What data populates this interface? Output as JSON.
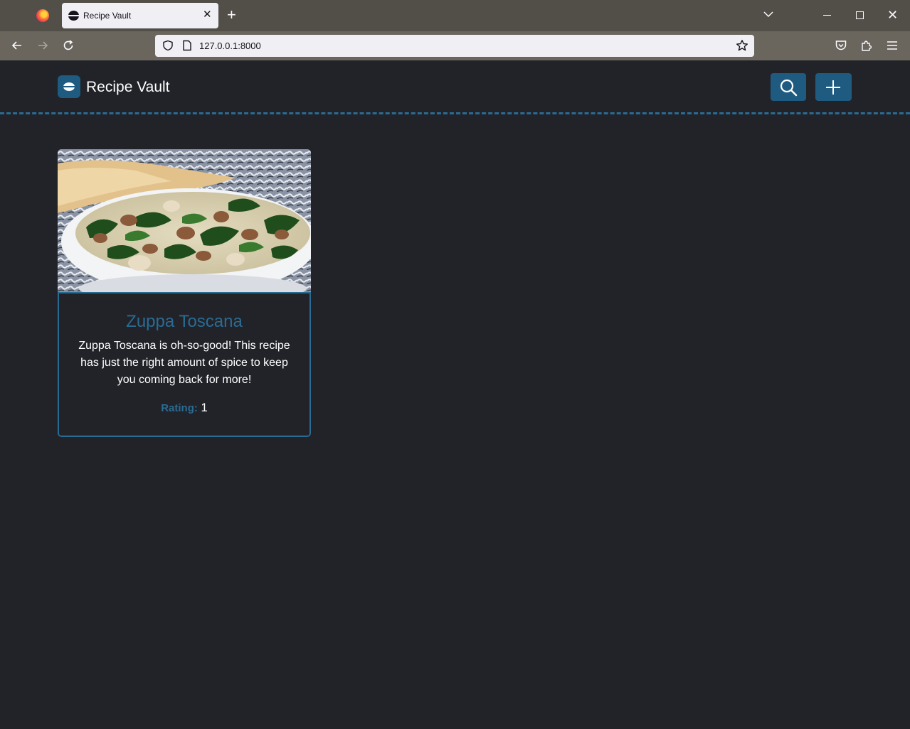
{
  "browser": {
    "tab_title": "Recipe Vault",
    "url": "127.0.0.1:8000",
    "icons": [
      "firefox-icon",
      "close-icon",
      "plus-icon",
      "chevron-down-icon",
      "minimize-icon",
      "maximize-icon",
      "close-icon",
      "back-arrow-icon",
      "forward-arrow-icon",
      "reload-icon",
      "shield-icon",
      "page-icon",
      "star-icon",
      "pocket-icon",
      "extensions-icon",
      "hamburger-menu-icon"
    ]
  },
  "header": {
    "brand": "Recipe Vault",
    "accent_color": "#1f5b80",
    "icons": [
      "search-icon",
      "plus-icon"
    ]
  },
  "recipes": [
    {
      "title": "Zuppa Toscana",
      "description": "Zuppa Toscana is oh-so-good! This recipe has just the right amount of spice to keep you coming back for more!",
      "rating_label": "Rating:",
      "rating": "1",
      "image": "soup-bowl-photo"
    }
  ]
}
